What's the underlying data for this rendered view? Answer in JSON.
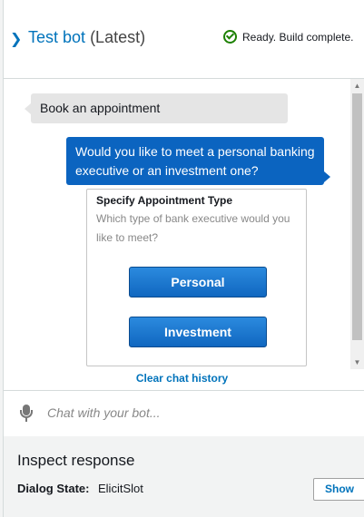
{
  "header": {
    "title": "Test bot",
    "version": "(Latest)",
    "status": "Ready. Build complete."
  },
  "chat": {
    "user_message": "Book an appointment",
    "bot_message": "Would you like to meet a personal banking executive or an investment one?",
    "card": {
      "title": "Specify Appointment Type",
      "subtitle": "Which type of bank executive would you like to meet?",
      "buttons": [
        "Personal",
        "Investment"
      ]
    },
    "clear_label": "Clear chat history"
  },
  "input": {
    "placeholder": "Chat with your bot..."
  },
  "inspect": {
    "title": "Inspect response",
    "dialog_state_label": "Dialog State:",
    "dialog_state_value": "ElicitSlot",
    "show_label": "Show"
  },
  "colors": {
    "accent": "#0073bb",
    "bot_bubble": "#0b64c0",
    "success": "#1d8102"
  }
}
